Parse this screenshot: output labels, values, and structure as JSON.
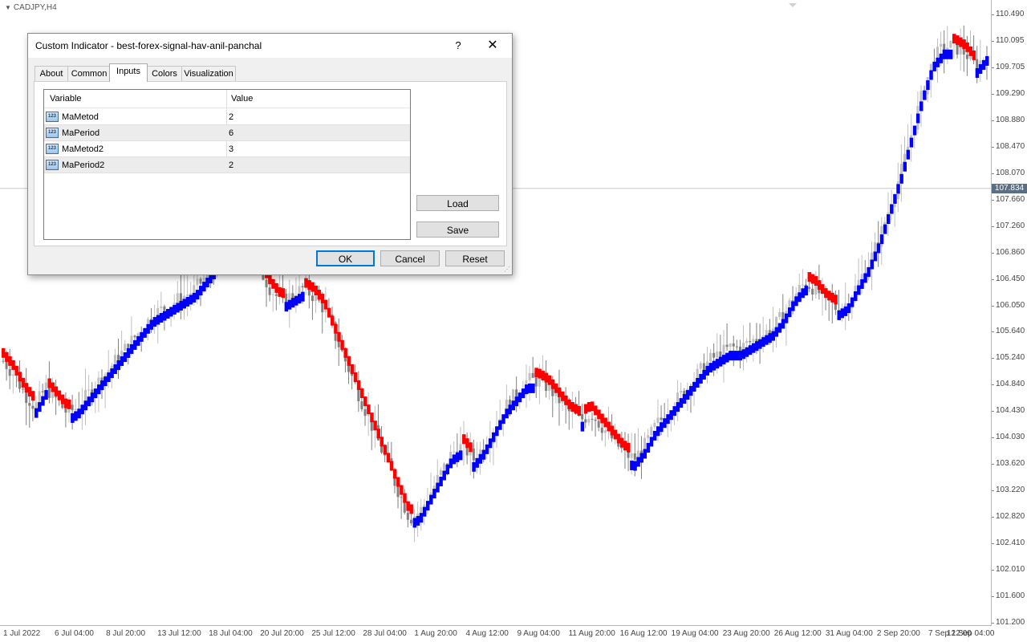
{
  "chart": {
    "symbol": "CADJPY,H4",
    "current_price": "107.834",
    "price_ticks": [
      "110.490",
      "110.095",
      "109.705",
      "109.290",
      "108.880",
      "108.470",
      "108.070",
      "107.660",
      "107.260",
      "106.860",
      "106.450",
      "106.050",
      "105.640",
      "105.240",
      "104.840",
      "104.430",
      "104.030",
      "103.620",
      "103.220",
      "102.820",
      "102.410",
      "102.010",
      "101.600",
      "101.200"
    ],
    "time_ticks": [
      "1 Jul 2022",
      "6 Jul 04:00",
      "8 Jul 20:00",
      "13 Jul 12:00",
      "18 Jul 04:00",
      "20 Jul 20:00",
      "25 Jul 12:00",
      "28 Jul 04:00",
      "1 Aug 20:00",
      "4 Aug 12:00",
      "9 Aug 04:00",
      "11 Aug 20:00",
      "16 Aug 12:00",
      "19 Aug 04:00",
      "23 Aug 20:00",
      "26 Aug 12:00",
      "31 Aug 04:00",
      "2 Sep 20:00",
      "7 Sep 12:00",
      "12 Sep 04:00"
    ],
    "colors": {
      "up": "#0000ff",
      "down": "#ff0000",
      "candle_light": "#c0c0c0",
      "candle_dark": "#808080",
      "current_line": "#c8c8c8"
    }
  },
  "chart_data": {
    "type": "candlestick",
    "ylim": [
      101.2,
      110.49
    ],
    "path_prices": [
      105.2,
      105.0,
      104.7,
      104.5,
      104.8,
      104.6,
      104.4,
      104.5,
      104.7,
      104.9,
      105.1,
      105.3,
      105.5,
      105.7,
      105.9,
      106.0,
      106.1,
      106.2,
      106.3,
      106.5,
      106.7,
      106.9,
      107.0,
      106.9,
      106.6,
      106.3,
      106.1,
      106.2,
      106.3,
      106.2,
      106.0,
      105.6,
      105.2,
      104.8,
      104.4,
      104.0,
      103.6,
      103.2,
      102.8,
      102.9,
      103.2,
      103.5,
      103.8,
      103.9,
      103.7,
      103.9,
      104.2,
      104.5,
      104.7,
      104.9,
      104.9,
      104.8,
      104.6,
      104.4,
      104.3,
      104.4,
      104.2,
      104.0,
      103.8,
      103.7,
      103.9,
      104.2,
      104.4,
      104.6,
      104.8,
      105.0,
      105.2,
      105.3,
      105.4,
      105.4,
      105.5,
      105.6,
      105.7,
      105.9,
      106.2,
      106.4,
      106.3,
      106.1,
      106.0,
      106.1,
      106.4,
      106.7,
      107.1,
      107.6,
      108.1,
      108.7,
      109.3,
      109.8,
      110.0,
      110.0,
      109.9,
      109.7,
      109.9
    ]
  },
  "dialog": {
    "title": "Custom Indicator - best-forex-signal-hav-anil-panchal",
    "help": "?",
    "close": "✕",
    "tabs": [
      {
        "label": "About"
      },
      {
        "label": "Common"
      },
      {
        "label": "Inputs"
      },
      {
        "label": "Colors"
      },
      {
        "label": "Visualization"
      }
    ],
    "active_tab": "Inputs",
    "grid": {
      "col_variable": "Variable",
      "col_value": "Value",
      "icon_text": "123",
      "rows": [
        {
          "variable": "MaMetod",
          "value": "2"
        },
        {
          "variable": "MaPeriod",
          "value": "6"
        },
        {
          "variable": "MaMetod2",
          "value": "3"
        },
        {
          "variable": "MaPeriod2",
          "value": "2"
        }
      ]
    },
    "buttons": {
      "load": "Load",
      "save": "Save",
      "ok": "OK",
      "cancel": "Cancel",
      "reset": "Reset"
    }
  }
}
